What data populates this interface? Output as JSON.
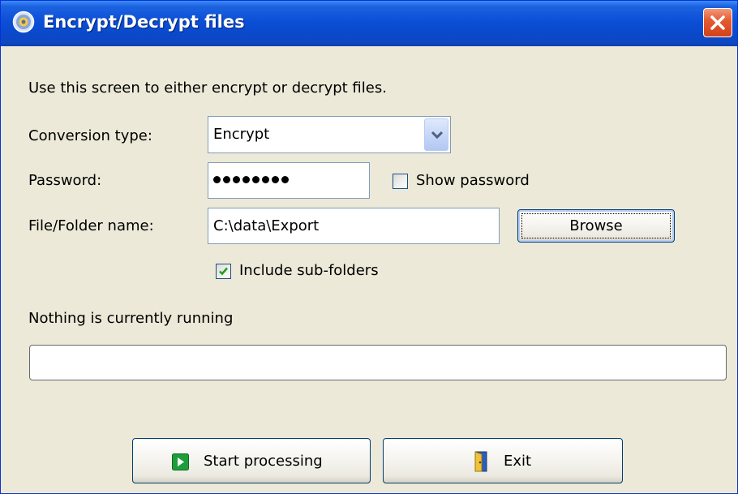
{
  "window": {
    "title": "Encrypt/Decrypt files"
  },
  "intro_text": "Use this screen to either encrypt or decrypt files.",
  "conversion": {
    "label": "Conversion type:",
    "selected": "Encrypt"
  },
  "password": {
    "label": "Password:",
    "masked_length": 8,
    "show_password_label": "Show password",
    "show_password_checked": false
  },
  "file": {
    "label": "File/Folder name:",
    "value": "C:\\data\\Export",
    "browse_label": "Browse"
  },
  "include_subfolders": {
    "label": "Include sub-folders",
    "checked": true
  },
  "status": {
    "text": "Nothing is currently running",
    "progress": 0
  },
  "actions": {
    "start_label": "Start processing",
    "exit_label": "Exit"
  },
  "icons": {
    "title": "app-disc-icon",
    "close": "close-icon",
    "dropdown": "chevron-down-icon",
    "start": "play-icon",
    "exit": "door-exit-icon",
    "check": "checkmark-icon"
  },
  "colors": {
    "titlebar": "#0a49cc",
    "window_bg": "#ece9d8",
    "close_button": "#e55c32",
    "field_border": "#7f9db9",
    "checkmark": "#21a121",
    "start_icon": "#1e9e3a"
  }
}
